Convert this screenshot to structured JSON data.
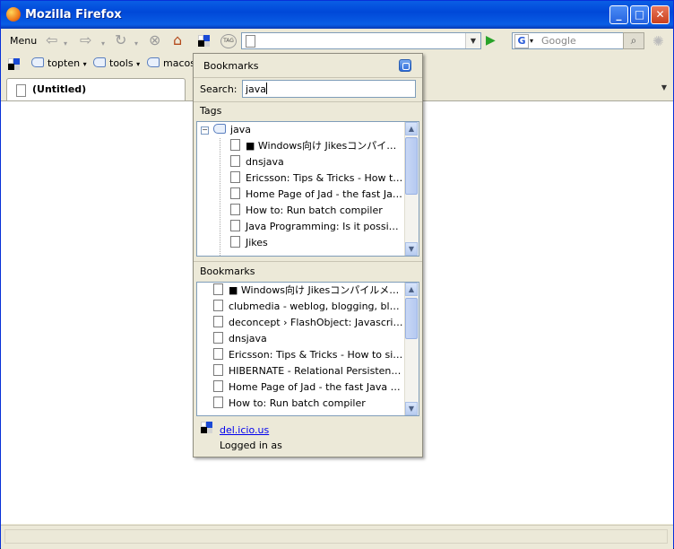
{
  "window": {
    "title": "Mozilla Firefox"
  },
  "titlebar_buttons": {
    "minimize": "_",
    "maximize": "□",
    "close": "✕"
  },
  "navbar": {
    "menu_label": "Menu",
    "url_value": "",
    "search_placeholder": "Google"
  },
  "bookmarks_toolbar": {
    "items": [
      {
        "label": "topten",
        "icon": "tag-icon",
        "has_dropdown": true
      },
      {
        "label": "tools",
        "icon": "tag-icon",
        "has_dropdown": true
      },
      {
        "label": "macos",
        "icon": "tag-icon",
        "has_dropdown": false
      }
    ]
  },
  "tabs": [
    {
      "label": "(Untitled)"
    }
  ],
  "popup": {
    "header": "Bookmarks",
    "search_label": "Search:",
    "search_value": "java",
    "tags_section": {
      "label": "Tags",
      "root_tag": "java",
      "items": [
        "■ Windows向け Jikesコンパイルメ...",
        "dnsjava",
        "Ericsson: Tips & Tricks - How to si...",
        "Home Page of Jad - the fast Java...",
        "How to: Run batch compiler",
        "Java Programming: Is it possible t...",
        "Jikes"
      ]
    },
    "bookmarks_section": {
      "label": "Bookmarks",
      "items": [
        "■ Windows向け Jikesコンパイルメモ ■",
        "clubmedia - weblog, blogging, blog so...",
        "deconcept › FlashObject: Javascript ...",
        "dnsjava",
        "Ericsson: Tips & Tricks - How to sign a...",
        "HIBERNATE - Relational Persistence f...",
        "Home Page of Jad - the fast Java de...",
        "How to: Run batch compiler"
      ]
    },
    "footer": {
      "link": "del.icio.us",
      "status": "Logged in as"
    }
  }
}
